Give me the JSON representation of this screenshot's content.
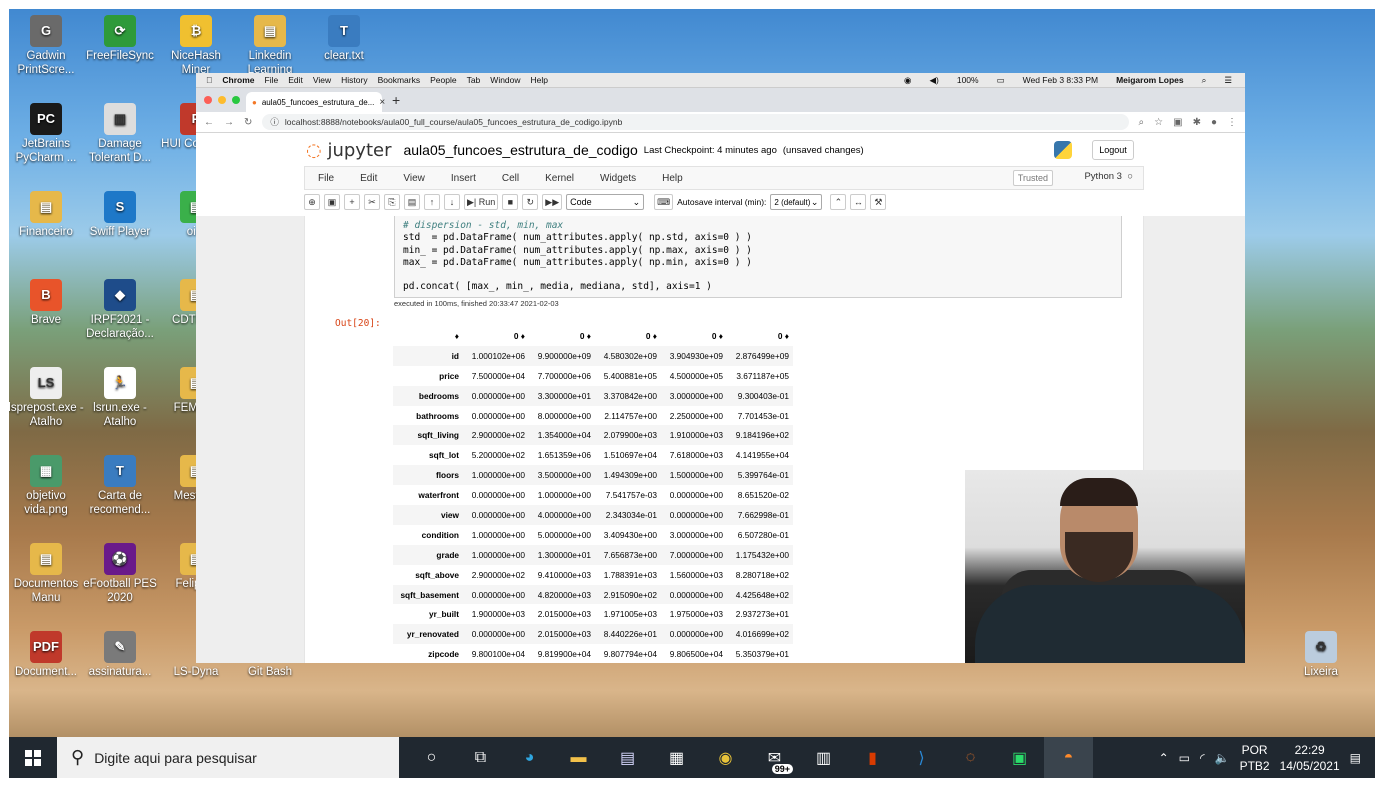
{
  "desktop": {
    "icons": [
      {
        "label": "Gadwin PrintScre...",
        "glyph": "G",
        "color": "#6a6a6a"
      },
      {
        "label": "FreeFileSync",
        "glyph": "⟳",
        "color": "#2e9a3a"
      },
      {
        "label": "NiceHash Miner",
        "glyph": "₿",
        "color": "#f0c030"
      },
      {
        "label": "Linkedin Learning",
        "glyph": "▤",
        "color": "#e6b84a"
      },
      {
        "label": "clear.txt",
        "glyph": "T",
        "color": "#3a7cc0"
      },
      {
        "label": "JetBrains PyCharm ...",
        "glyph": "PC",
        "color": "#1a1a1a"
      },
      {
        "label": "Damage Tolerant D...",
        "glyph": "▥",
        "color": "#dddddd"
      },
      {
        "label": "HUI Compa...",
        "glyph": "P",
        "color": "#c0392b"
      },
      {
        "label": "Financeiro",
        "glyph": "▤",
        "color": "#e6b84a"
      },
      {
        "label": "Swiff Player",
        "glyph": "S",
        "color": "#1e78c8"
      },
      {
        "label": "oi...",
        "glyph": "▤",
        "color": "#3ab04a"
      },
      {
        "label": "Brave",
        "glyph": "B",
        "color": "#e8542a"
      },
      {
        "label": "IRPF2021 - Declaração...",
        "glyph": "◆",
        "color": "#1e4c8a"
      },
      {
        "label": "CDTN_...",
        "glyph": "▤",
        "color": "#e6b84a"
      },
      {
        "label": "lsprepost.exe - Atalho",
        "glyph": "LS",
        "color": "#eeeeee"
      },
      {
        "label": "lsrun.exe - Atalho",
        "glyph": "🏃",
        "color": "#ffffff"
      },
      {
        "label": "FEM &...",
        "glyph": "▤",
        "color": "#e6b84a"
      },
      {
        "label": "objetivo vida.png",
        "glyph": "▦",
        "color": "#4a9a6a"
      },
      {
        "label": "Carta de recomend...",
        "glyph": "T",
        "color": "#3a7cc0"
      },
      {
        "label": "Mestra...",
        "glyph": "▤",
        "color": "#e6b84a"
      },
      {
        "label": "Documentos Manu",
        "glyph": "▤",
        "color": "#e6b84a"
      },
      {
        "label": "eFootball PES 2020",
        "glyph": "⚽",
        "color": "#6a1a8a"
      },
      {
        "label": "Felipe...",
        "glyph": "▤",
        "color": "#e6b84a"
      },
      {
        "label": "Document...",
        "glyph": "PDF",
        "color": "#c0392b"
      },
      {
        "label": "assinatura...",
        "glyph": "✎",
        "color": "#7a7a7a"
      },
      {
        "label": "LS-Dyna",
        "glyph": "",
        "color": "transparent"
      },
      {
        "label": "Git Bash",
        "glyph": "",
        "color": "transparent"
      },
      {
        "label": "Lixeira",
        "glyph": "♻",
        "color": "#bcd"
      }
    ]
  },
  "macbar": {
    "app": "Chrome",
    "menus": [
      "File",
      "Edit",
      "View",
      "History",
      "Bookmarks",
      "People",
      "Tab",
      "Window",
      "Help"
    ],
    "battery": "100%",
    "datetime": "Wed Feb 3  8:33 PM",
    "user": "Meigarom Lopes"
  },
  "browser": {
    "tab_title": "aula05_funcoes_estrutura_de...",
    "url": "localhost:8888/notebooks/aula00_full_course/aula05_funcoes_estrutura_de_codigo.ipynb"
  },
  "jupyter": {
    "logo": "jupyter",
    "notebook_title": "aula05_funcoes_estrutura_de_codigo",
    "checkpoint": "Last Checkpoint: 4 minutes ago",
    "unsaved": "(unsaved changes)",
    "logout": "Logout",
    "menus": [
      "File",
      "Edit",
      "View",
      "Insert",
      "Cell",
      "Kernel",
      "Widgets",
      "Help"
    ],
    "trusted": "Trusted",
    "kernel": "Python 3",
    "toolbar": {
      "run": "Run",
      "cell_type": "Code",
      "autosave_label": "Autosave interval (min):",
      "autosave_value": "2 (default)"
    },
    "code_lines": {
      "comment": "# dispersion - std, min, max",
      "line1": "std  = pd.DataFrame( num_attributes.apply( np.std, axis=0 ) )",
      "line2": "min_ = pd.DataFrame( num_attributes.apply( np.max, axis=0 ) )",
      "line3": "max_ = pd.DataFrame( num_attributes.apply( np.min, axis=0 ) )",
      "line4": "pd.concat( [max_, min_, media, mediana, std], axis=1 )"
    },
    "exec_info": "executed in 100ms, finished 20:33:47 2021-02-03",
    "out_prompt": "Out[20]:",
    "table": {
      "headers": [
        "0",
        "0",
        "0",
        "0",
        "0"
      ],
      "rows": [
        {
          "name": "id",
          "v": [
            "1.000102e+06",
            "9.900000e+09",
            "4.580302e+09",
            "3.904930e+09",
            "2.876499e+09"
          ]
        },
        {
          "name": "price",
          "v": [
            "7.500000e+04",
            "7.700000e+06",
            "5.400881e+05",
            "4.500000e+05",
            "3.671187e+05"
          ]
        },
        {
          "name": "bedrooms",
          "v": [
            "0.000000e+00",
            "3.300000e+01",
            "3.370842e+00",
            "3.000000e+00",
            "9.300403e-01"
          ]
        },
        {
          "name": "bathrooms",
          "v": [
            "0.000000e+00",
            "8.000000e+00",
            "2.114757e+00",
            "2.250000e+00",
            "7.701453e-01"
          ]
        },
        {
          "name": "sqft_living",
          "v": [
            "2.900000e+02",
            "1.354000e+04",
            "2.079900e+03",
            "1.910000e+03",
            "9.184196e+02"
          ]
        },
        {
          "name": "sqft_lot",
          "v": [
            "5.200000e+02",
            "1.651359e+06",
            "1.510697e+04",
            "7.618000e+03",
            "4.141955e+04"
          ]
        },
        {
          "name": "floors",
          "v": [
            "1.000000e+00",
            "3.500000e+00",
            "1.494309e+00",
            "1.500000e+00",
            "5.399764e-01"
          ]
        },
        {
          "name": "waterfront",
          "v": [
            "0.000000e+00",
            "1.000000e+00",
            "7.541757e-03",
            "0.000000e+00",
            "8.651520e-02"
          ]
        },
        {
          "name": "view",
          "v": [
            "0.000000e+00",
            "4.000000e+00",
            "2.343034e-01",
            "0.000000e+00",
            "7.662998e-01"
          ]
        },
        {
          "name": "condition",
          "v": [
            "1.000000e+00",
            "5.000000e+00",
            "3.409430e+00",
            "3.000000e+00",
            "6.507280e-01"
          ]
        },
        {
          "name": "grade",
          "v": [
            "1.000000e+00",
            "1.300000e+01",
            "7.656873e+00",
            "7.000000e+00",
            "1.175432e+00"
          ]
        },
        {
          "name": "sqft_above",
          "v": [
            "2.900000e+02",
            "9.410000e+03",
            "1.788391e+03",
            "1.560000e+03",
            "8.280718e+02"
          ]
        },
        {
          "name": "sqft_basement",
          "v": [
            "0.000000e+00",
            "4.820000e+03",
            "2.915090e+02",
            "0.000000e+00",
            "4.425648e+02"
          ]
        },
        {
          "name": "yr_built",
          "v": [
            "1.900000e+03",
            "2.015000e+03",
            "1.971005e+03",
            "1.975000e+03",
            "2.937273e+01"
          ]
        },
        {
          "name": "yr_renovated",
          "v": [
            "0.000000e+00",
            "2.015000e+03",
            "8.440226e+01",
            "0.000000e+00",
            "4.016699e+02"
          ]
        },
        {
          "name": "zipcode",
          "v": [
            "9.800100e+04",
            "9.819900e+04",
            "9.807794e+04",
            "9.806500e+04",
            "5.350379e+01"
          ]
        }
      ]
    }
  },
  "taskbar": {
    "search_placeholder": "Digite aqui para pesquisar",
    "badge": "99+",
    "lang1": "POR",
    "lang2": "PTB2",
    "time": "22:29",
    "date": "14/05/2021"
  }
}
